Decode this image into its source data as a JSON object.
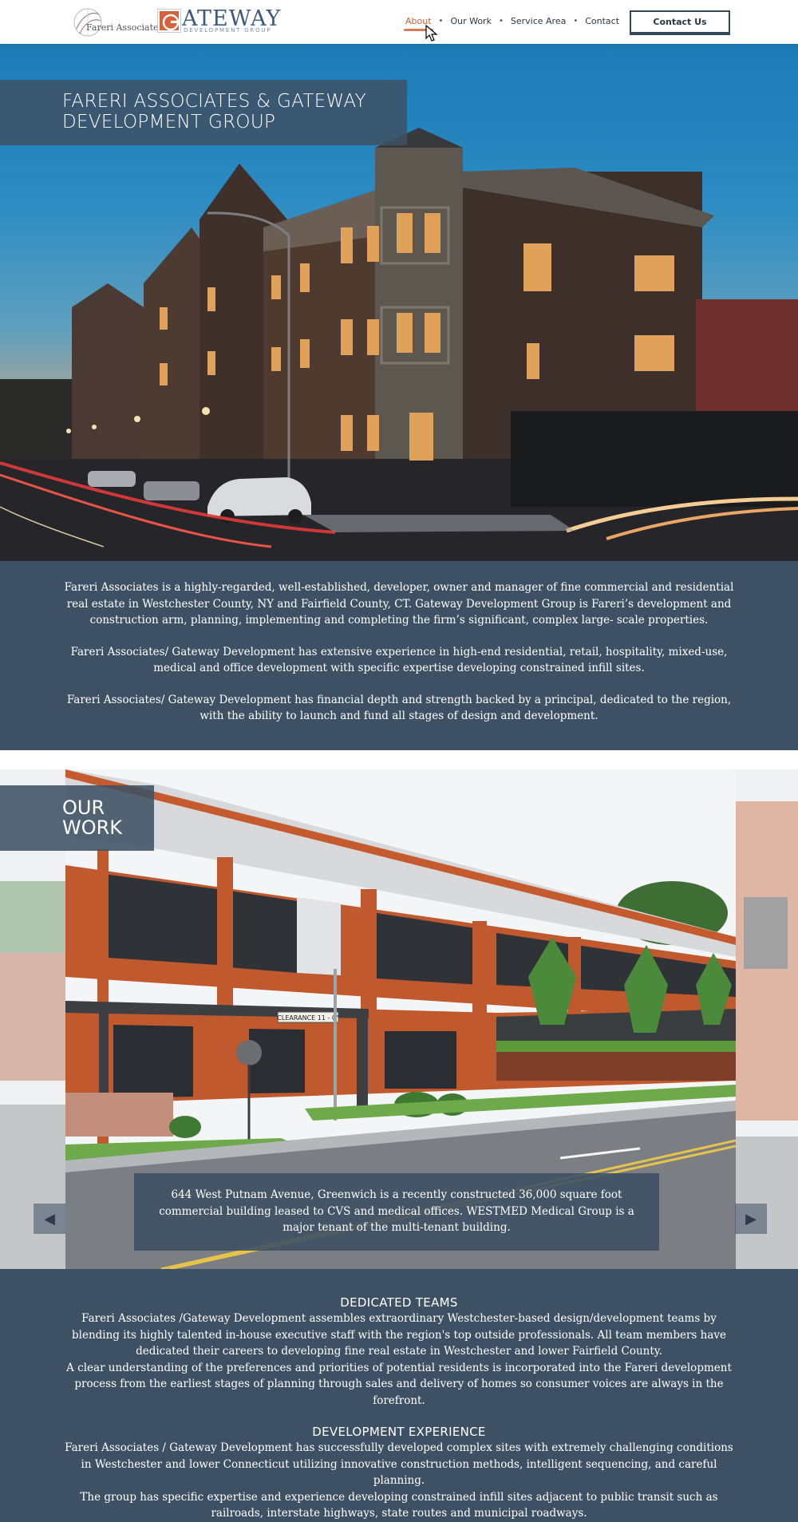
{
  "header": {
    "logo_fareri": "Fareri Associates",
    "logo_gateway_word": "ATEWAY",
    "logo_gateway_sub": "DEVELOPMENT GROUP",
    "nav": [
      "About",
      "Our Work",
      "Service Area",
      "Contact"
    ],
    "active_nav": "About",
    "contact_button": "Contact Us"
  },
  "hero": {
    "title_line1": "FARERI ASSOCIATES & GATEWAY",
    "title_line2": "DEVELOPMENT GROUP"
  },
  "about": {
    "paragraphs": [
      "Fareri Associates is a highly-regarded, well-established, developer, owner and manager of  fine commercial and residential real estate in Westchester County, NY and Fairfield County, CT.  Gateway Development Group is Fareri’s development and construction arm, planning, implementing and completing the firm’s significant, complex large- scale properties.",
      "Fareri Associates/ Gateway Development has extensive experience in high-end residential, retail, hospitality, mixed-use, medical and office development with specific expertise developing constrained infill sites.",
      "Fareri Associates/ Gateway Development has financial depth and strength backed by a principal, dedicated to the region, with the ability to launch and fund all stages of design and development."
    ]
  },
  "work": {
    "title_line1": "OUR",
    "title_line2": "WORK",
    "caption": "644 West Putnam Avenue, Greenwich is a recently constructed 36,000 square foot commercial building leased to CVS and medical offices. WESTMED Medical Group is a major tenant of the multi-tenant building.",
    "sign_text": "CLEARANCE  11 - 0\"",
    "prev_label": "◀",
    "next_label": "▶"
  },
  "teams": {
    "heading1": "DEDICATED TEAMS",
    "text1a": "Fareri Associates /Gateway Development assembles extraordinary Westchester-based design/development teams by blending its highly talented in-house executive staff with the region's top outside professionals. All team members have dedicated their careers to developing fine real estate in Westchester and lower Fairfield County.",
    "text1b": "A clear understanding of the preferences and priorities of potential residents is incorporated into the Fareri development  process from the earliest stages of planning through sales and delivery of homes so consumer voices are always in the forefront.",
    "heading2": "DEVELOPMENT EXPERIENCE",
    "text2a": "Fareri Associates / Gateway Development has successfully developed complex sites with extremely challenging conditions in Westchester and lower Connecticut utilizing innovative construction methods, intelligent sequencing, and careful planning.",
    "text2b": "The group has specific expertise and experience developing constrained infill sites adjacent to public transit such as railroads, interstate highways, state routes and municipal roadways."
  },
  "colors": {
    "panel": "#3e5164",
    "accent": "#d97a55",
    "brick": "#c0592d"
  }
}
